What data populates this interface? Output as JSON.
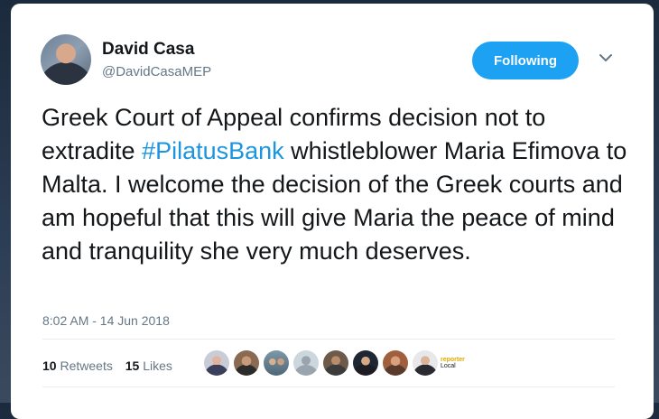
{
  "author": {
    "name": "David Casa",
    "handle": "@DavidCasaMEP"
  },
  "follow_button": {
    "label": "Following"
  },
  "tweet": {
    "text_before": "Greek Court of Appeal confirms decision not to extradite ",
    "hashtag": "#PilatusBank",
    "text_after": " whistleblower Maria Efimova to Malta. I welcome the decision of the Greek courts and am hopeful that this will give Maria the peace of mind and tranquility she very much deserves."
  },
  "timestamp": "8:02 AM - 14 Jun 2018",
  "stats": {
    "retweets_count": "10",
    "retweets_label": "Retweets",
    "likes_count": "15",
    "likes_label": "Likes"
  },
  "likers": {
    "last_label_main": "reporter",
    "last_label_sub": "Local"
  },
  "colors": {
    "accent": "#1da1f2",
    "hashtag": "#1b95e0",
    "text": "#14171a",
    "muted": "#657786"
  }
}
